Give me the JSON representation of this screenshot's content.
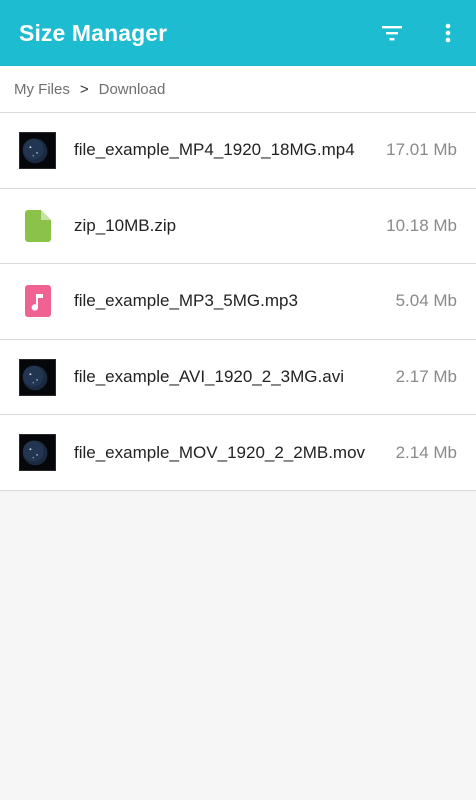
{
  "app": {
    "title": "Size Manager",
    "accent_color": "#1ebcd1",
    "actions": [
      {
        "icon": "filter-icon"
      },
      {
        "icon": "more-vert-icon"
      }
    ]
  },
  "breadcrumb": {
    "root": "My Files",
    "separator": ">",
    "current": "Download"
  },
  "files": [
    {
      "name": "file_example_MP4_1920_18MG.mp4",
      "size": "17.01 Mb",
      "icon": "video-thumbnail-icon"
    },
    {
      "name": "zip_10MB.zip",
      "size": "10.18 Mb",
      "icon": "zip-file-icon",
      "icon_color": "#8bc34a"
    },
    {
      "name": "file_example_MP3_5MG.mp3",
      "size": "5.04 Mb",
      "icon": "audio-file-icon",
      "icon_color": "#f06292"
    },
    {
      "name": "file_example_AVI_1920_2_3MG.avi",
      "size": "2.17 Mb",
      "icon": "video-thumbnail-icon"
    },
    {
      "name": "file_example_MOV_1920_2_2MB.mov",
      "size": "2.14 Mb",
      "icon": "video-thumbnail-icon"
    }
  ]
}
